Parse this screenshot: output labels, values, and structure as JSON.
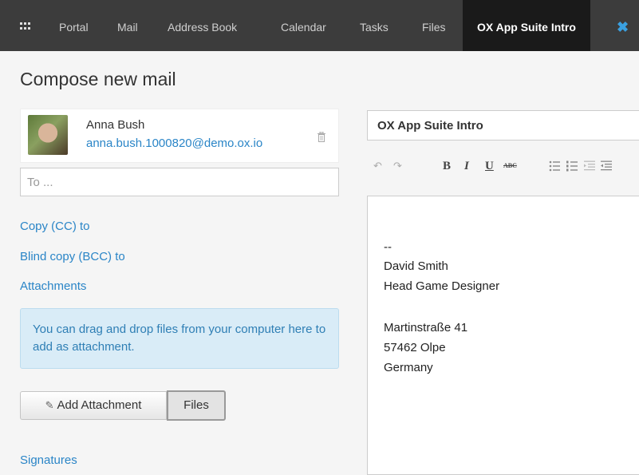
{
  "topbar": {
    "tabs": [
      "Portal",
      "Mail",
      "Address Book",
      "Calendar",
      "Tasks",
      "Files"
    ],
    "active_tab": "OX App Suite Intro",
    "close_glyph": "✖"
  },
  "compose": {
    "title": "Compose new mail",
    "sender": {
      "name": "Anna Bush",
      "email": "anna.bush.1000820@demo.ox.io"
    },
    "to_placeholder": "To ...",
    "links": {
      "cc": "Copy (CC) to",
      "bcc": "Blind copy (BCC) to",
      "attachments": "Attachments",
      "signatures": "Signatures"
    },
    "dropzone_text": "You can drag and drop files from your computer here to add as attachment.",
    "buttons": {
      "add_attachment": "Add Attachment",
      "files": "Files"
    }
  },
  "editor": {
    "subject": "OX App Suite Intro",
    "toolbar": {
      "undo": "↶",
      "redo": "↷",
      "bold": "B",
      "italic": "I",
      "underline": "U",
      "strike": "ABC"
    },
    "signature": {
      "dashes": "--",
      "name": "David Smith",
      "role": "Head Game Designer",
      "street": "Martinstraße 41",
      "city": "57462 Olpe",
      "country": "Germany"
    }
  },
  "icons": {
    "apps": "apps-grid-icon",
    "delete": "trash-icon",
    "paperclip": "paperclip-icon",
    "bullets": "bullet-list-icon",
    "numbers": "numbered-list-icon",
    "outdent": "outdent-icon",
    "indent": "indent-icon"
  },
  "colors": {
    "topbar": "#3c3c3c",
    "active_tab": "#1a1a1a",
    "link": "#2a85c7",
    "dropzone_bg": "#d9ecf7",
    "dropzone_text": "#2f7fb5"
  }
}
